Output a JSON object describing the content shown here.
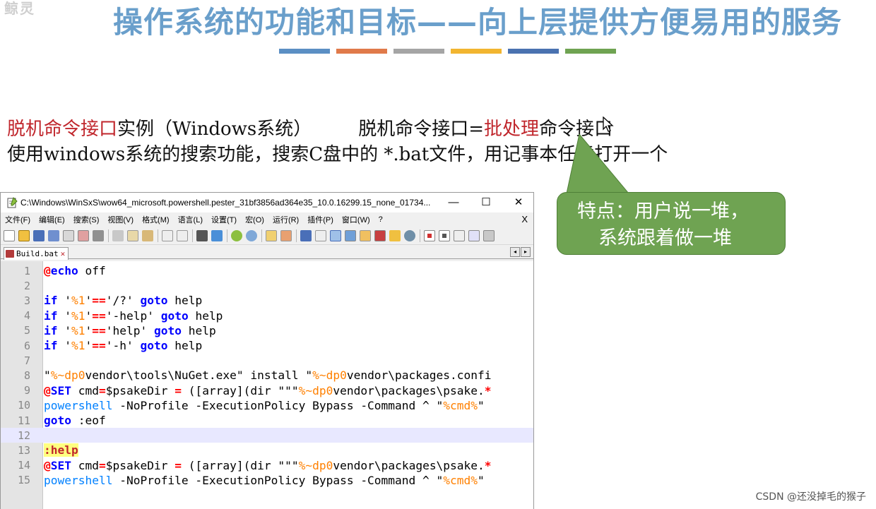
{
  "slide": {
    "logo_text": "鲸灵",
    "title": "操作系统的功能和目标——向上层提供方便易用的服务",
    "accent_bars": [
      "#5b8fc4",
      "#e07a4a",
      "#a5a5a5",
      "#f2b530",
      "#4a72b0",
      "#6fa352"
    ],
    "line1": {
      "part1_red": "脱机命令接口",
      "part2": "实例（Windows系统）",
      "part3": "脱机命令接口=",
      "part4_red": "批处理",
      "part5": "命令接口"
    },
    "line2": "使用windows系统的搜索功能，搜索C盘中的 *.bat文件，用记事本任意打开一个",
    "callout": {
      "line1": "特点：用户说一堆，",
      "line2": "系统跟着做一堆"
    },
    "watermark": "CSDN @还没掉毛的猴子"
  },
  "editor": {
    "window_title": "C:\\Windows\\WinSxS\\wow64_microsoft.powershell.pester_31bf3856ad364e35_10.0.16299.15_none_01734...",
    "controls": {
      "minimize": "—",
      "maximize": "☐",
      "close": "✕"
    },
    "menu": [
      "文件(F)",
      "编辑(E)",
      "搜索(S)",
      "视图(V)",
      "格式(M)",
      "语言(L)",
      "设置(T)",
      "宏(O)",
      "运行(R)",
      "插件(P)",
      "窗口(W)",
      "?"
    ],
    "menu_close": "X",
    "tab_label": "Build.bat",
    "tab_close": "✕",
    "tab_prev": "◂",
    "tab_next": "▸",
    "line_numbers": [
      "1",
      "2",
      "3",
      "4",
      "5",
      "6",
      "7",
      "8",
      "9",
      "10",
      "11",
      "12",
      "13",
      "14",
      "15"
    ],
    "current_line": 12
  }
}
